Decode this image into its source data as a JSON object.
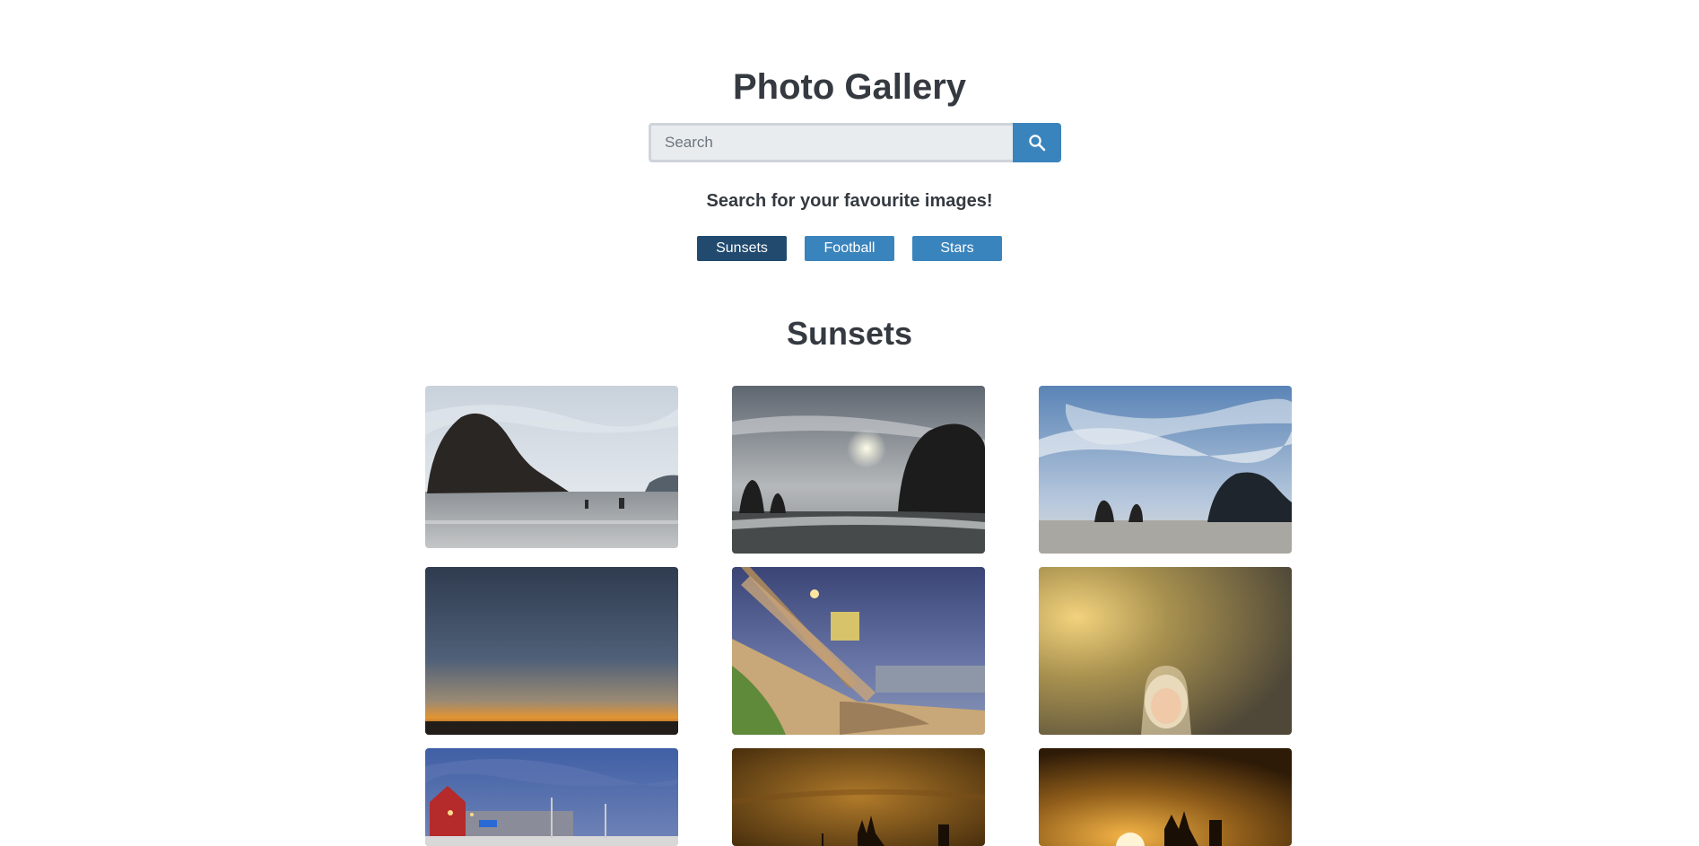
{
  "header": {
    "title": "Photo Gallery"
  },
  "search": {
    "placeholder": "Search",
    "value": "",
    "button_icon": "search-icon"
  },
  "tagline": "Search for your favourite images!",
  "categories": [
    {
      "label": "Sunsets",
      "active": true
    },
    {
      "label": "Football",
      "active": false
    },
    {
      "label": "Stars",
      "active": false
    }
  ],
  "gallery": {
    "title": "Sunsets",
    "photos": [
      {
        "description": "haystack-rock-beach-overcast"
      },
      {
        "description": "haystack-rock-sun-through-clouds"
      },
      {
        "description": "haystack-rock-blue-sky"
      },
      {
        "description": "twilight-horizon-sunset"
      },
      {
        "description": "beach-stairs-lifeguard-tower"
      },
      {
        "description": "woman-in-forest-sunlight"
      },
      {
        "description": "harbor-boats-red-building"
      },
      {
        "description": "city-silhouette-golden-sky"
      },
      {
        "description": "sun-behind-cathedral-silhouette"
      }
    ]
  },
  "colors": {
    "primary": "#3a84bd",
    "active": "#214a6e",
    "text": "#343a40"
  }
}
